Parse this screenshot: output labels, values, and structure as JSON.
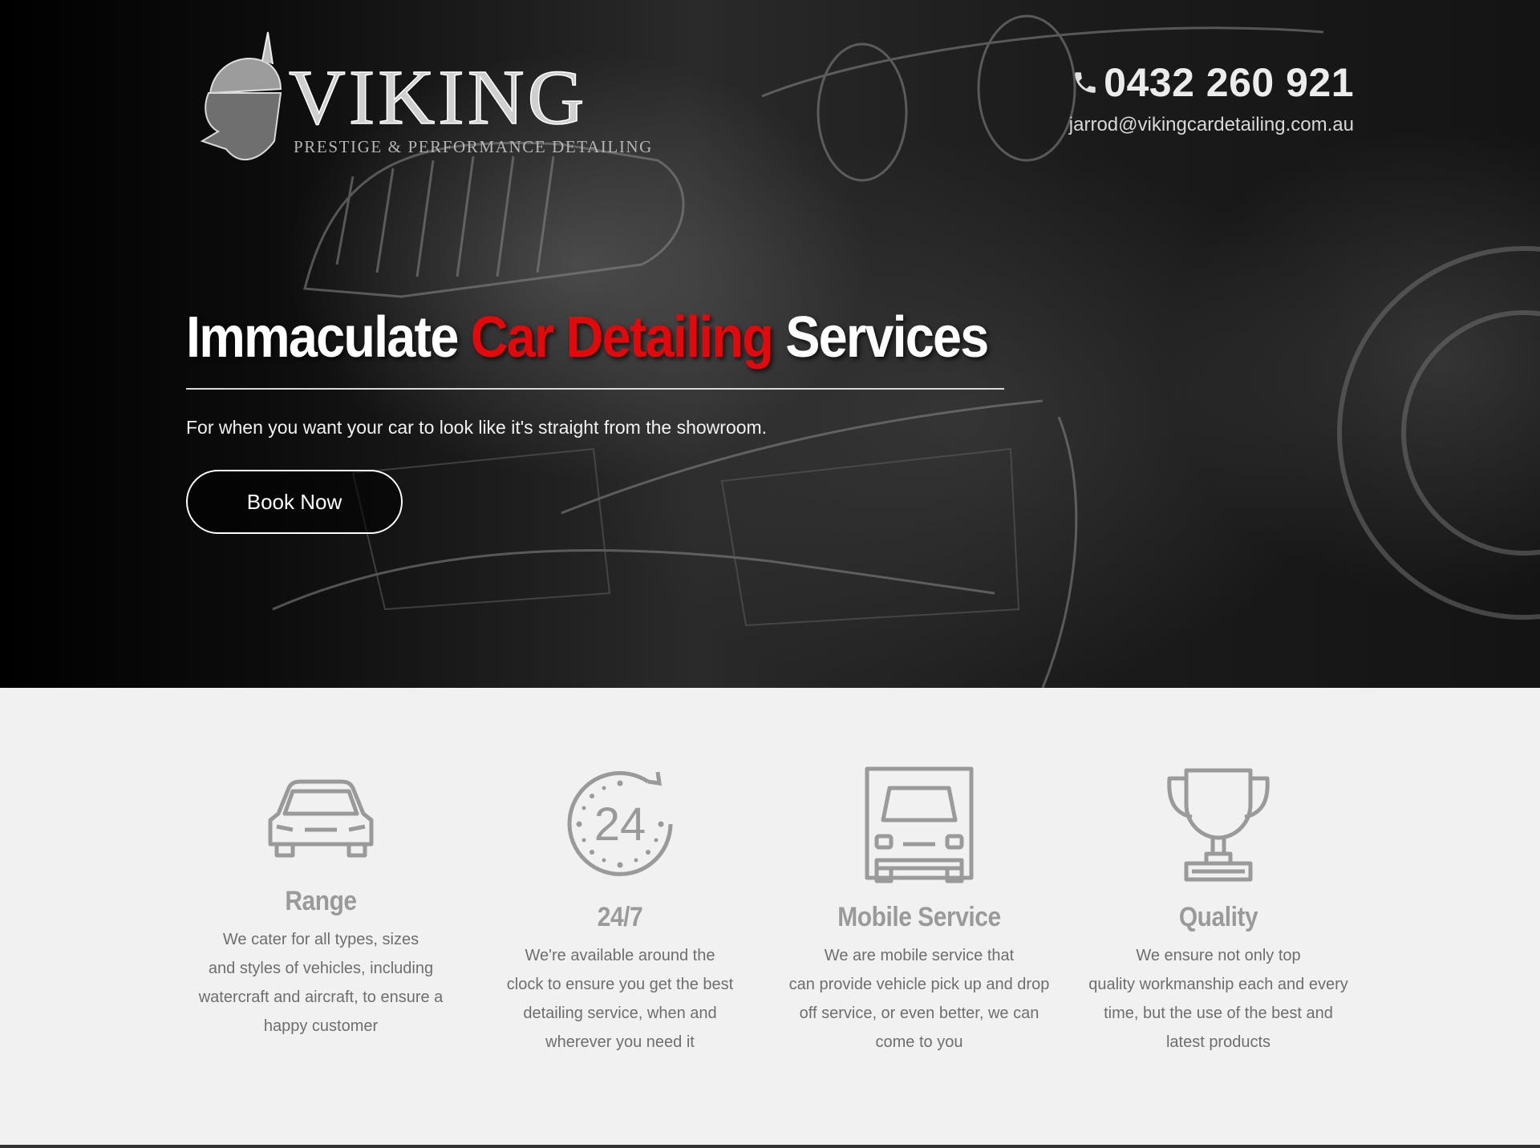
{
  "header": {
    "logo": {
      "title": "VIKING",
      "subtitle": "PRESTIGE & PERFORMANCE DETAILING"
    },
    "phone": "0432 260 921",
    "email": "jarrod@vikingcardetailing.com.au"
  },
  "hero": {
    "headline_part1": "Immaculate ",
    "headline_accent": "Car Detailing",
    "headline_part2": " Services",
    "tagline": "For when you want your car to look like it's straight from the showroom.",
    "cta_label": "Book Now"
  },
  "features": [
    {
      "icon": "car-icon",
      "title": "Range",
      "text": "We cater for all types, sizes\nand styles of vehicles, including\nwatercraft and aircraft, to ensure a\nhappy customer"
    },
    {
      "icon": "clock-24-icon",
      "title": "24/7",
      "text": "We're available around the\nclock to ensure you get the best\ndetailing service, when and\nwherever you need it"
    },
    {
      "icon": "truck-icon",
      "title": "Mobile Service",
      "text": "We are mobile service that\ncan provide vehicle pick up and drop\noff service, or even better, we can\ncome to you"
    },
    {
      "icon": "trophy-icon",
      "title": "Quality",
      "text": "We ensure not only top\nquality workmanship each and every\ntime, but the use of the best and\nlatest products"
    }
  ],
  "colors": {
    "accent": "#e5080b",
    "icon_grey": "#9a9a9a",
    "section_bg": "#f2f1f1"
  }
}
